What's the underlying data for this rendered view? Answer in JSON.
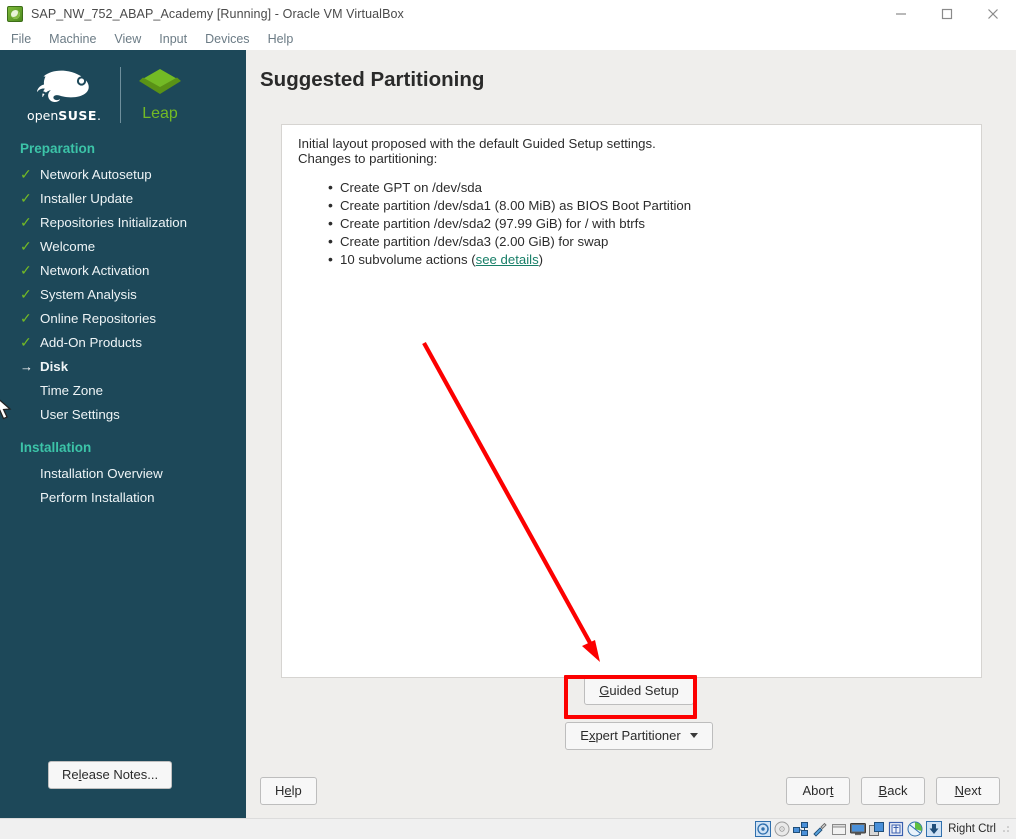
{
  "window": {
    "title": "SAP_NW_752_ABAP_Academy [Running] - Oracle VM VirtualBox",
    "app_icon": "virtualbox-icon",
    "minimize": "—",
    "maximize": "□",
    "close": "✕"
  },
  "menubar": {
    "items": [
      {
        "label": "File"
      },
      {
        "label": "Machine"
      },
      {
        "label": "View"
      },
      {
        "label": "Input"
      },
      {
        "label": "Devices"
      },
      {
        "label": "Help"
      }
    ]
  },
  "sidebar": {
    "brand": {
      "distro_open": "open",
      "distro_name": "SUSE",
      "distro_tm": ".",
      "product": "Leap"
    },
    "sections": [
      {
        "heading": "Preparation",
        "items": [
          {
            "label": "Network Autosetup",
            "state": "done"
          },
          {
            "label": "Installer Update",
            "state": "done"
          },
          {
            "label": "Repositories Initialization",
            "state": "done"
          },
          {
            "label": "Welcome",
            "state": "done"
          },
          {
            "label": "Network Activation",
            "state": "done"
          },
          {
            "label": "System Analysis",
            "state": "done"
          },
          {
            "label": "Online Repositories",
            "state": "done"
          },
          {
            "label": "Add-On Products",
            "state": "done"
          },
          {
            "label": "Disk",
            "state": "current"
          },
          {
            "label": "Time Zone",
            "state": "pending"
          },
          {
            "label": "User Settings",
            "state": "pending"
          }
        ]
      },
      {
        "heading": "Installation",
        "items": [
          {
            "label": "Installation Overview",
            "state": "pending"
          },
          {
            "label": "Perform Installation",
            "state": "pending"
          }
        ]
      }
    ],
    "check_glyph": "✓",
    "arrow_glyph": "→",
    "release_notes": {
      "prefix": "Re",
      "accel": "l",
      "suffix": "ease Notes..."
    }
  },
  "main": {
    "title": "Suggested Partitioning",
    "lead": "Initial layout proposed with the default Guided Setup settings.",
    "subhead": "Changes to partitioning:",
    "changes": [
      {
        "text": "Create GPT on /dev/sda"
      },
      {
        "text": "Create partition /dev/sda1 (8.00 MiB) as BIOS Boot Partition"
      },
      {
        "text": "Create partition /dev/sda2 (97.99 GiB) for / with btrfs"
      },
      {
        "text": "Create partition /dev/sda3 (2.00 GiB) for swap"
      },
      {
        "text": "10 subvolume actions (",
        "link": "see details",
        "suffix": ")"
      }
    ],
    "guided_setup": {
      "accel": "G",
      "rest": "uided Setup"
    },
    "expert_partitioner": {
      "prefix": "E",
      "accel_underline": "x",
      "rest": "pert Partitioner"
    },
    "help": {
      "prefix": "H",
      "accel": "e",
      "suffix": "lp"
    },
    "abort": {
      "prefix": "Abor",
      "accel": "t",
      "suffix": ""
    },
    "back": {
      "prefix": "",
      "accel": "B",
      "suffix": "ack"
    },
    "next": {
      "prefix": "",
      "accel": "N",
      "suffix": "ext"
    }
  },
  "annotation": {
    "highlight_color": "#fc0000",
    "arrow_color": "#fc0000",
    "arrow_from": "424,343",
    "arrow_to": "600,660",
    "highlight_target": "Guided Setup"
  },
  "statusbar": {
    "icons": [
      "hard-disk-icon",
      "optical-disk-icon",
      "network-icon",
      "usb-icon",
      "shared-folder-icon",
      "display-icon",
      "shared-clipboard-icon",
      "vm-cpu-icon",
      "remote-desktop-icon",
      "host-key-icon"
    ],
    "host_key": "Right Ctrl"
  },
  "colors": {
    "sidebar_bg": "#1d4859",
    "section_heading": "#3cc4a8",
    "check_green": "#73ba25",
    "leap_green": "#73ba25",
    "link_teal": "#187f68",
    "content_bg": "#efeeec",
    "panel_bg": "#ffffff"
  }
}
